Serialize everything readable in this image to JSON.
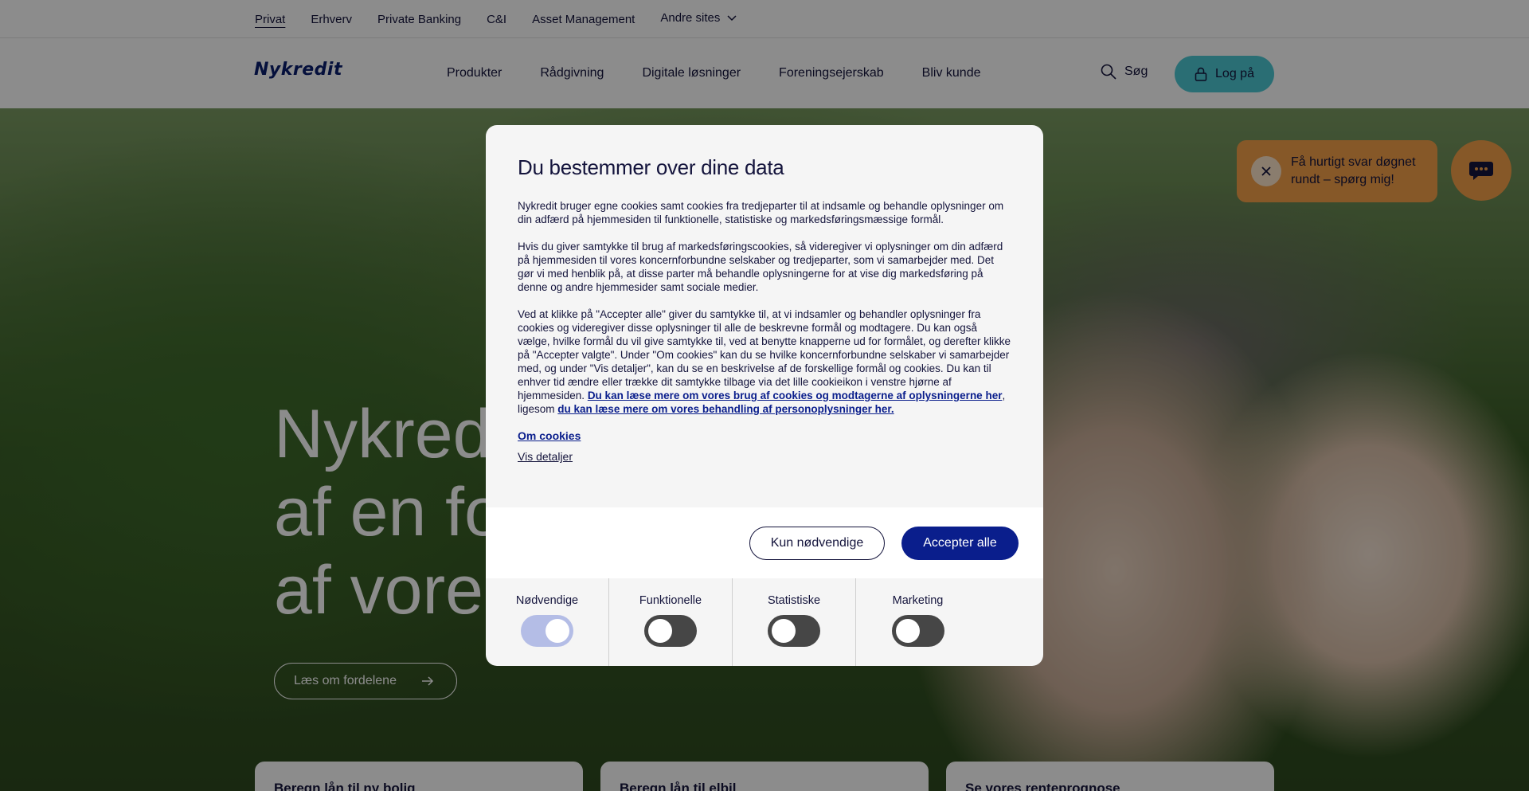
{
  "topbar": {
    "items": [
      "Privat",
      "Erhverv",
      "Private Banking",
      "C&I",
      "Asset Management"
    ],
    "other_sites": "Andre sites"
  },
  "header": {
    "logo": "Nykredit",
    "nav": [
      "Produkter",
      "Rådgivning",
      "Digitale løsninger",
      "Foreningsejerskab",
      "Bliv kunde"
    ],
    "search_label": "Søg",
    "login_label": "Log på"
  },
  "hero": {
    "title_lines": [
      "Nykred",
      "af en fo",
      "af vore"
    ],
    "cta": "Læs om fordelene"
  },
  "chat": {
    "bubble_text": "Få hurtigt svar døgnet rundt – spørg mig!"
  },
  "cards": [
    "Beregn lån til ny bolig",
    "Beregn lån til elbil",
    "Se vores renteprognose"
  ],
  "cookie_modal": {
    "title": "Du bestemmer over dine data",
    "p1": "Nykredit bruger egne cookies samt cookies fra tredjeparter til at indsamle og behandle oplysninger om din adfærd på hjemmesiden til funktionelle, statistiske og markedsføringsmæssige formål.",
    "p2": "Hvis du giver samtykke til brug af markedsføringscookies, så videregiver vi oplysninger om din adfærd på hjemmesiden til vores koncernforbundne selskaber og tredjeparter, som vi samarbejder med. Det gør vi med henblik på, at disse parter må behandle oplysningerne for at vise dig markedsføring på denne og andre hjemmesider samt sociale medier.",
    "p3": "Ved at klikke på \"Accepter alle\" giver du samtykke til, at vi indsamler og behandler oplysninger fra cookies og videregiver disse oplysninger til alle de beskrevne formål og modtagere. Du kan også vælge, hvilke formål du vil give samtykke til, ved at benytte knapperne ud for formålet, og derefter klikke på \"Accepter valgte\". Under \"Om cookies\" kan du se hvilke koncernforbundne selskaber vi samarbejder med, og under \"Vis detaljer\", kan du se en beskrivelse af de forskellige formål og cookies. Du kan til enhver tid ændre eller trække dit samtykke tilbage via det lille cookieikon i venstre hjørne af hjemmesiden.",
    "p3_link1": "Du kan læse mere om vores brug af cookies og modtagerne af oplysningerne her",
    "p3_between": ", ligesom",
    "p3_link2": "du kan læse mere om vores behandling af personoplysninger her.",
    "link_about": "Om cookies",
    "link_details": "Vis detaljer",
    "btn_necessary": "Kun nødvendige",
    "btn_accept_all": "Accepter alle",
    "toggles": [
      {
        "label": "Nødvendige",
        "on": true
      },
      {
        "label": "Funktionelle",
        "on": false
      },
      {
        "label": "Statistiske",
        "on": false
      },
      {
        "label": "Marketing",
        "on": false
      }
    ]
  },
  "colors": {
    "brand_navy": "#0a1e8c",
    "login_teal": "#4ec9d4",
    "chat_orange": "#f5a04a"
  }
}
